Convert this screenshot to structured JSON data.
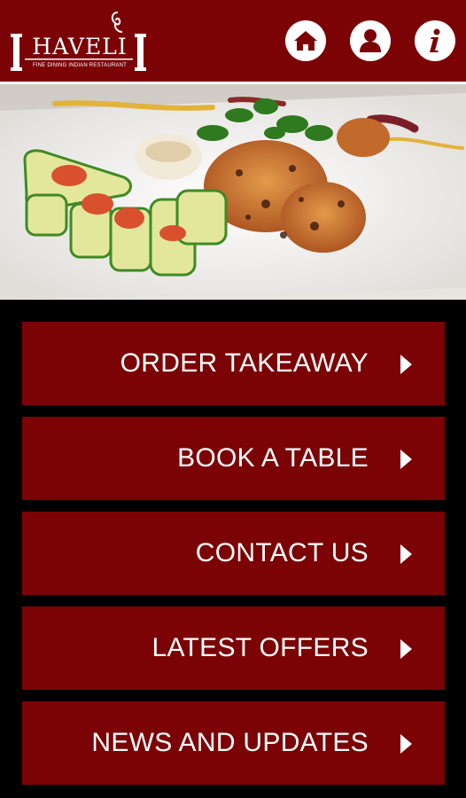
{
  "app": {
    "logo_name": "HAVELI",
    "logo_tagline": "FINE DINING INDIAN RESTAURANT"
  },
  "header": {
    "icons": [
      "home-icon",
      "user-icon",
      "info-icon"
    ]
  },
  "menu": {
    "items": [
      {
        "label": "ORDER TAKEAWAY"
      },
      {
        "label": "BOOK A TABLE"
      },
      {
        "label": "CONTACT US"
      },
      {
        "label": "LATEST OFFERS"
      },
      {
        "label": "NEWS AND UPDATES"
      }
    ]
  },
  "colors": {
    "brand": "#7b0305",
    "background": "#000000",
    "text": "#ffffff"
  }
}
